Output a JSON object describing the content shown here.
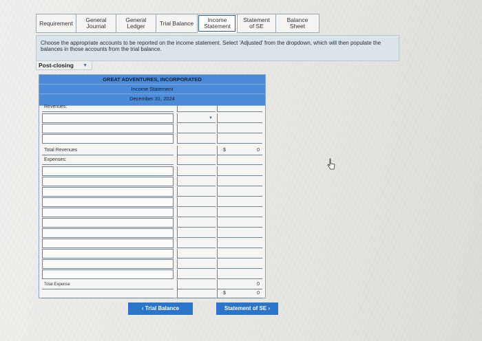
{
  "tabs": [
    {
      "label": "Requirement"
    },
    {
      "label": "General Journal"
    },
    {
      "label": "General Ledger"
    },
    {
      "label": "Trial Balance"
    },
    {
      "label": "Income Statement"
    },
    {
      "label": "Statement of SE"
    },
    {
      "label": "Balance Sheet"
    }
  ],
  "instructions": "Choose the appropriate accounts to be reported on the income statement. Select 'Adjusted' from the dropdown, which will then populate the balances in those accounts from the trial balance.",
  "balance_select": {
    "value": "Post-closing"
  },
  "statement": {
    "company": "GREAT ADVENTURES, INCORPORATED",
    "title": "Income Statement",
    "date": "December 31, 2024"
  },
  "rows": {
    "revenues_label": "Revenues:",
    "total_revenues_label": "Total Revenues",
    "total_revenues_dollar": "$",
    "total_revenues_value": "0",
    "expenses_label": "Expenses:",
    "total_expense_label": "Total Expense",
    "total_expense_value": "0",
    "net_dollar": "$",
    "net_value": "0"
  },
  "buttons": {
    "prev": "‹  Trial Balance",
    "next": "Statement of SE  ›"
  },
  "colors": {
    "header": "#4a8ad6",
    "button": "#2a74c9",
    "instructions_bg": "#dbe4ea"
  }
}
